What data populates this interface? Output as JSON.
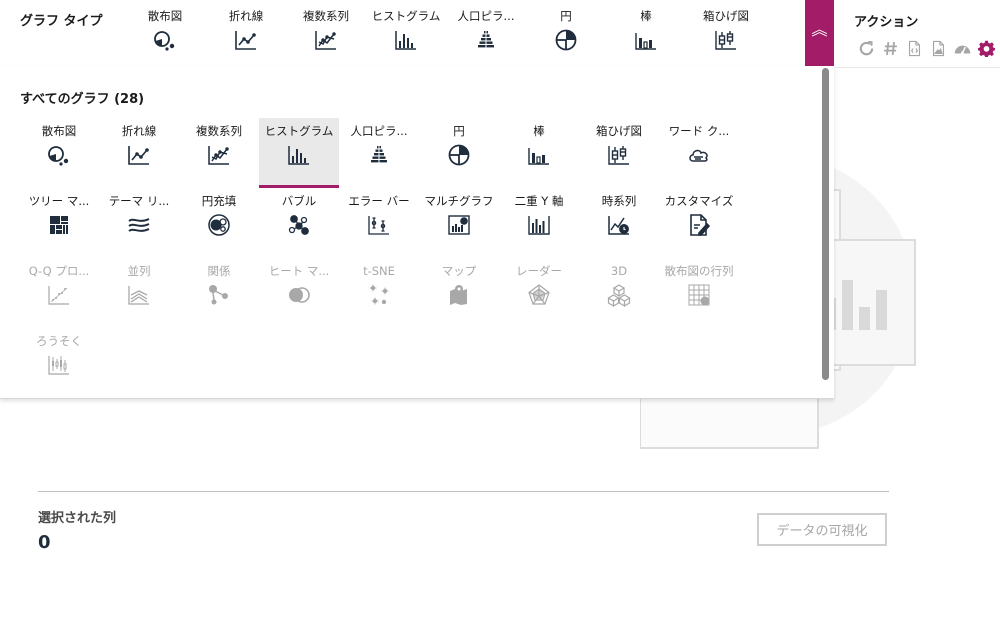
{
  "chart_type_bar": {
    "title": "グラフ タイプ",
    "items": [
      {
        "label": "散布図",
        "icon": "scatter-icon"
      },
      {
        "label": "折れ線",
        "icon": "line-icon"
      },
      {
        "label": "複数系列",
        "icon": "multi-series-icon"
      },
      {
        "label": "ヒストグラム",
        "icon": "histogram-icon"
      },
      {
        "label": "人口ピラ...",
        "icon": "pyramid-icon"
      },
      {
        "label": "円",
        "icon": "pie-icon"
      },
      {
        "label": "棒",
        "icon": "bar-icon"
      },
      {
        "label": "箱ひげ図",
        "icon": "boxplot-icon"
      }
    ]
  },
  "actions": {
    "title": "アクション",
    "icons": [
      "refresh-icon",
      "hash-icon",
      "code-file-icon",
      "image-file-icon",
      "dashboard-icon",
      "settings-icon"
    ],
    "accent_color": "#a21c68"
  },
  "collapse_button": {
    "icon": "double-chevron-up-icon",
    "color": "#a21c68"
  },
  "all_charts": {
    "title": "すべてのグラフ (28)",
    "items": [
      {
        "label": "散布図",
        "icon": "scatter-icon",
        "enabled": true,
        "selected": false
      },
      {
        "label": "折れ線",
        "icon": "line-icon",
        "enabled": true,
        "selected": false
      },
      {
        "label": "複数系列",
        "icon": "multi-series-icon",
        "enabled": true,
        "selected": false
      },
      {
        "label": "ヒストグラム",
        "icon": "histogram-icon",
        "enabled": true,
        "selected": true
      },
      {
        "label": "人口ピラ...",
        "icon": "pyramid-icon",
        "enabled": true,
        "selected": false
      },
      {
        "label": "円",
        "icon": "pie-icon",
        "enabled": true,
        "selected": false
      },
      {
        "label": "棒",
        "icon": "bar-icon",
        "enabled": true,
        "selected": false
      },
      {
        "label": "箱ひげ図",
        "icon": "boxplot-icon",
        "enabled": true,
        "selected": false
      },
      {
        "label": "ワード ク...",
        "icon": "word-cloud-icon",
        "enabled": true,
        "selected": false
      },
      {
        "label": "ツリー マ...",
        "icon": "treemap-icon",
        "enabled": true,
        "selected": false
      },
      {
        "label": "テーマ リ...",
        "icon": "theme-river-icon",
        "enabled": true,
        "selected": false
      },
      {
        "label": "円充填",
        "icon": "circle-packing-icon",
        "enabled": true,
        "selected": false
      },
      {
        "label": "バブル",
        "icon": "bubble-icon",
        "enabled": true,
        "selected": false
      },
      {
        "label": "エラー バー",
        "icon": "error-bar-icon",
        "enabled": true,
        "selected": false
      },
      {
        "label": "マルチグラフ",
        "icon": "multi-chart-icon",
        "enabled": true,
        "selected": false
      },
      {
        "label": "二重 Y 軸",
        "icon": "dual-y-axis-icon",
        "enabled": true,
        "selected": false
      },
      {
        "label": "時系列",
        "icon": "time-series-icon",
        "enabled": true,
        "selected": false
      },
      {
        "label": "カスタマイズ",
        "icon": "customize-icon",
        "enabled": true,
        "selected": false
      },
      {
        "label": "Q-Q プロ...",
        "icon": "qq-plot-icon",
        "enabled": false,
        "selected": false
      },
      {
        "label": "並列",
        "icon": "parallel-icon",
        "enabled": false,
        "selected": false
      },
      {
        "label": "関係",
        "icon": "relation-icon",
        "enabled": false,
        "selected": false
      },
      {
        "label": "ヒート マ...",
        "icon": "heatmap-icon",
        "enabled": false,
        "selected": false
      },
      {
        "label": "t-SNE",
        "icon": "tsne-icon",
        "enabled": false,
        "selected": false
      },
      {
        "label": "マップ",
        "icon": "map-icon",
        "enabled": false,
        "selected": false
      },
      {
        "label": "レーダー",
        "icon": "radar-icon",
        "enabled": false,
        "selected": false
      },
      {
        "label": "3D",
        "icon": "3d-icon",
        "enabled": false,
        "selected": false
      },
      {
        "label": "散布図の行列",
        "icon": "scatter-matrix-icon",
        "enabled": false,
        "selected": false
      },
      {
        "label": "ろうそく",
        "icon": "candlestick-icon",
        "enabled": false,
        "selected": false
      }
    ]
  },
  "selection": {
    "label": "選択された列",
    "count": "0"
  },
  "visualize_button": {
    "label": "データの可視化",
    "enabled": false
  },
  "colors": {
    "accent": "#a21c68",
    "icon": "#1f2d3d",
    "disabled": "#a8a8a8"
  }
}
